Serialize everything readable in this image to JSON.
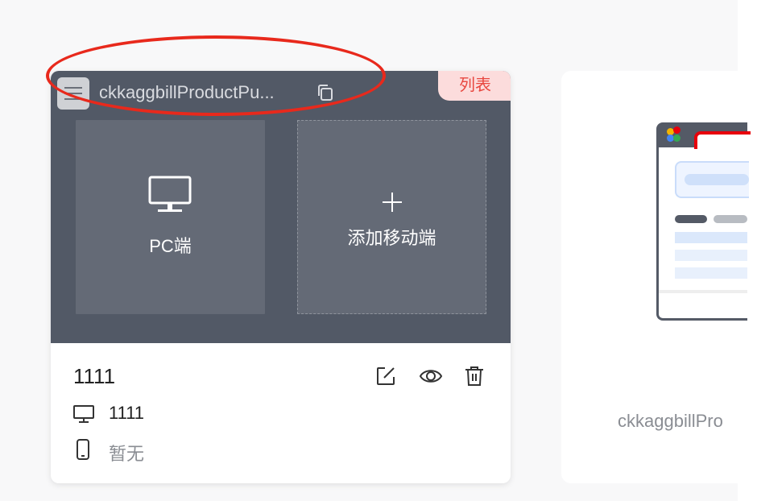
{
  "card": {
    "name": "ckkaggbillProductPu...",
    "badge": "列表",
    "pc_label": "PC端",
    "add_mobile_label": "添加移动端",
    "title": "1111",
    "pc_value": "1111",
    "mobile_value": "暂无"
  },
  "card2": {
    "name": "ckkaggbillPro"
  },
  "icons": {
    "menu": "menu-icon",
    "copy": "copy-icon",
    "monitor": "monitor-icon",
    "plus": "plus-icon",
    "edit": "edit-icon",
    "view": "eye-icon",
    "delete": "trash-icon",
    "pc_small": "monitor-icon",
    "mobile": "mobile-icon"
  },
  "colors": {
    "preview_bg": "#525966",
    "tile_bg": "#646a76",
    "badge_bg": "#fcdcdc",
    "badge_text": "#e8473f",
    "annotation": "#e8291c"
  }
}
